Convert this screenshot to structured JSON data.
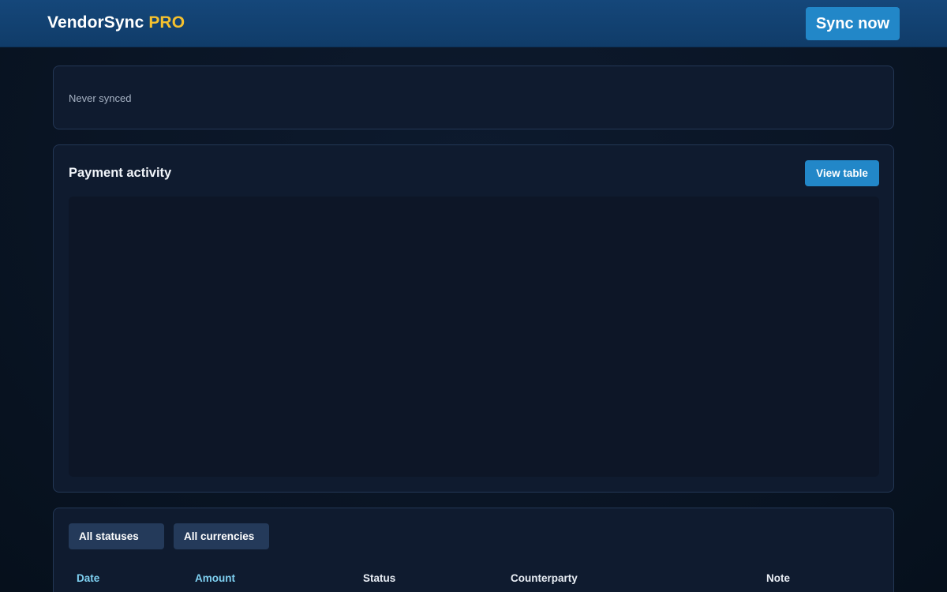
{
  "header": {
    "brand_name": "VendorSync",
    "brand_tier": "PRO",
    "sync_button": "Sync now"
  },
  "sync_status": {
    "text": "Never synced"
  },
  "payment_activity": {
    "title": "Payment activity",
    "view_table_button": "View table"
  },
  "filters": {
    "status": "All statuses",
    "currency": "All currencies"
  },
  "table": {
    "columns": [
      "Date",
      "Amount",
      "Status",
      "Counterparty",
      "Note"
    ]
  },
  "colors": {
    "header_bg": "#15477a",
    "accent_button": "#2287c8",
    "brand_tier": "#f5c12e",
    "sortable_header": "#7fd1f2",
    "card_bg": "#0f1b2f"
  }
}
